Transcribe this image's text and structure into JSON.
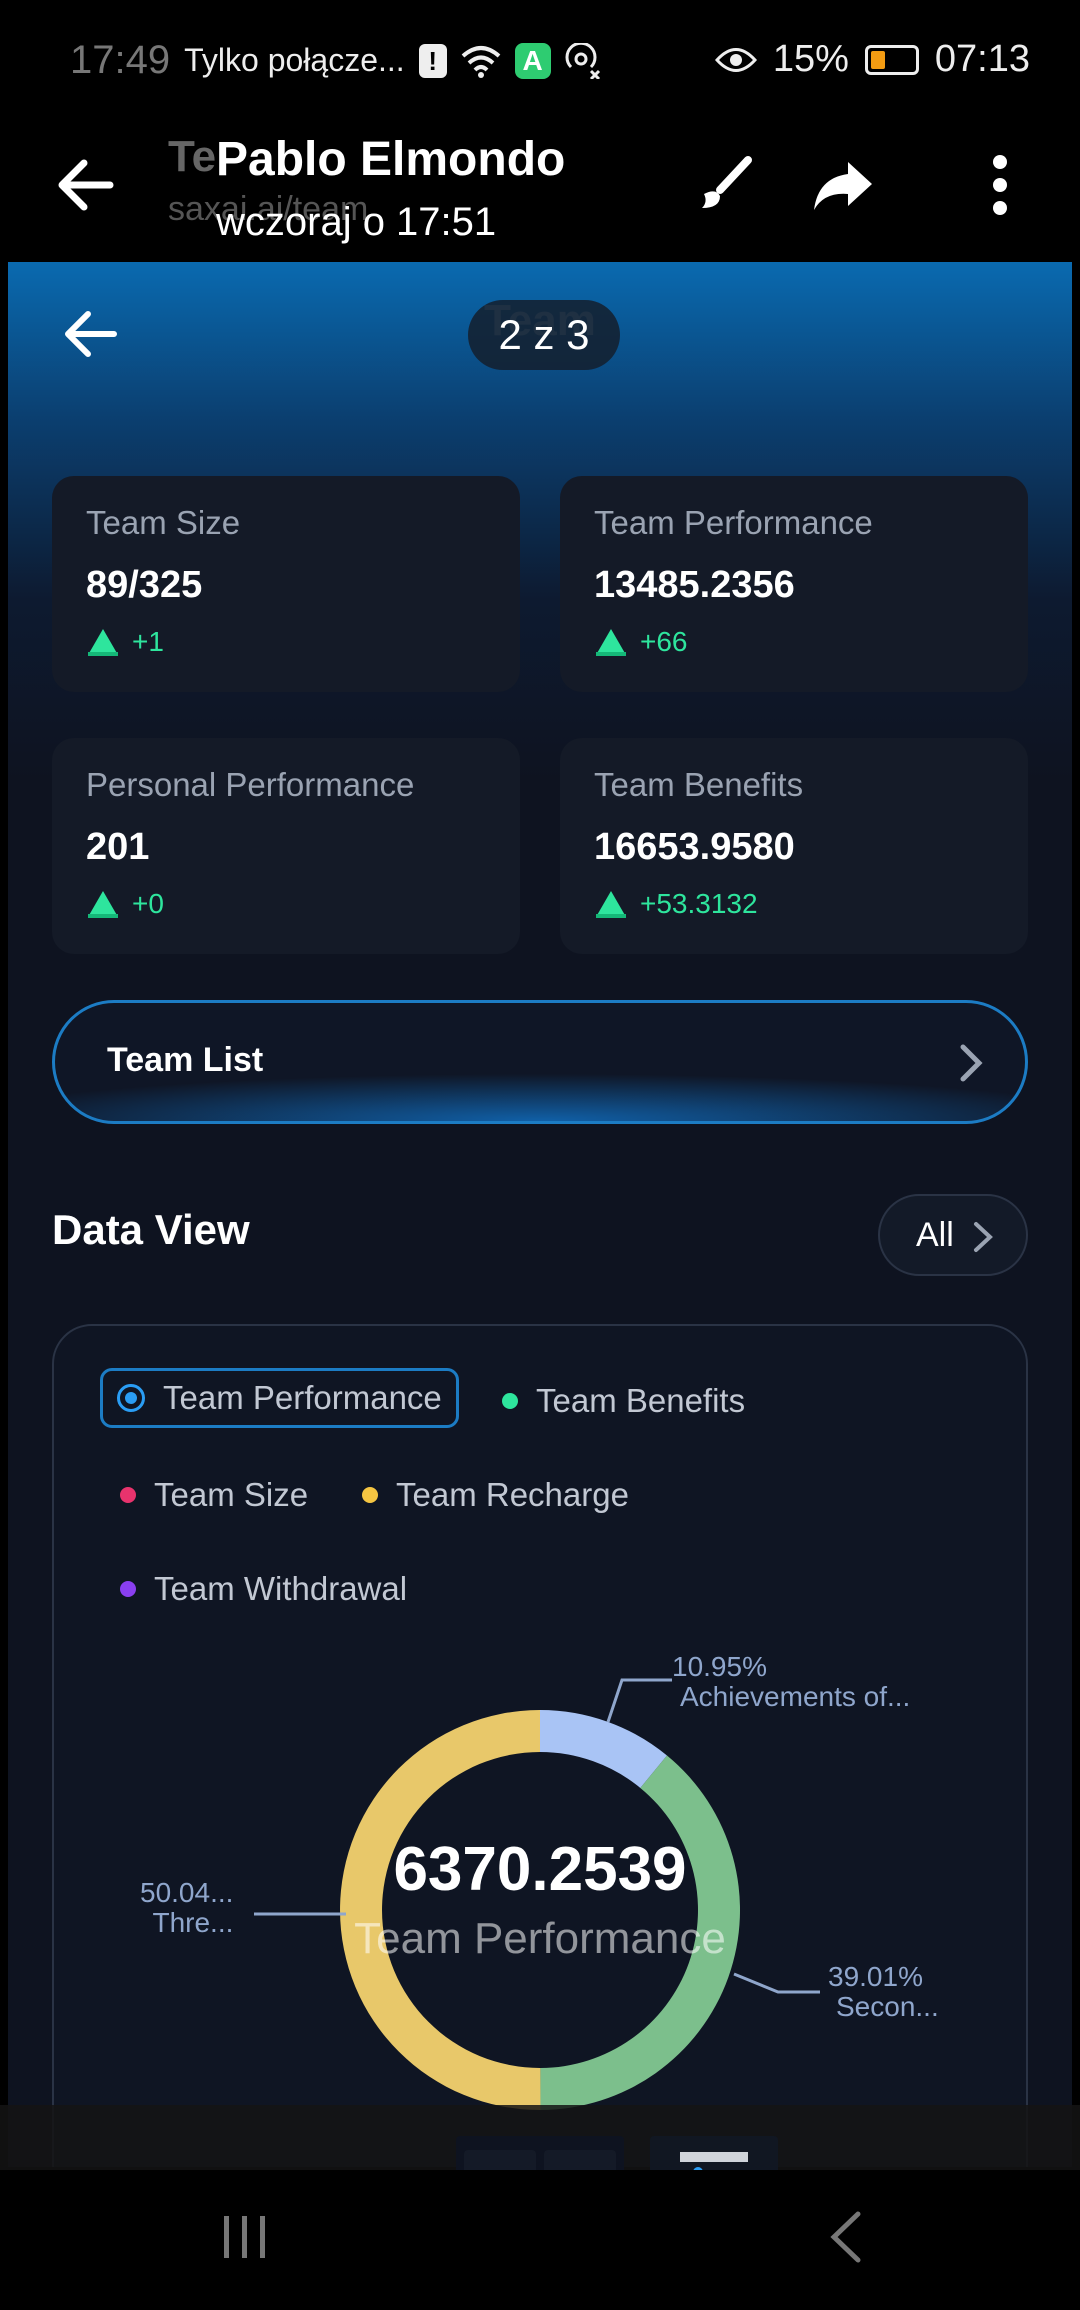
{
  "status_bar": {
    "time_ghost": "17:49",
    "carrier": "Tylko połącze...",
    "battery": "15%",
    "time": "07:13"
  },
  "viewer_header": {
    "ghost_title": "Te",
    "ghost_url": "saxai.ai/team",
    "sender": "Pablo Elmondo",
    "date": "wczoraj o 17:51"
  },
  "app": {
    "title": "Team",
    "counter": "2 z 3",
    "cards": [
      {
        "label": "Team Size",
        "value": "89/325",
        "delta": "+1"
      },
      {
        "label": "Team Performance",
        "value": "13485.2356",
        "delta": "+66"
      },
      {
        "label": "Personal Performance",
        "value": "201",
        "delta": "+0"
      },
      {
        "label": "Team Benefits",
        "value": "16653.9580",
        "delta": "+53.3132"
      }
    ],
    "team_list_label": "Team List",
    "data_view_title": "Data View",
    "all_label": "All",
    "legend": [
      {
        "label": "Team Performance",
        "color": "#2a9df4",
        "active": true
      },
      {
        "label": "Team Benefits",
        "color": "#2ee59d"
      },
      {
        "label": "Team Size",
        "color": "#e8336d"
      },
      {
        "label": "Team Recharge",
        "color": "#f5c542"
      },
      {
        "label": "Team Withdrawal",
        "color": "#8a3ff0"
      }
    ],
    "donut": {
      "center_value": "6370.2539",
      "center_label": "Team Performance",
      "segments": [
        {
          "percent_label": "10.95%",
          "name": "Achievements of...",
          "value": 10.95,
          "color": "#a9c4f5"
        },
        {
          "percent_label": "39.01%",
          "name": "Secon...",
          "value": 39.01,
          "color": "#7cbf8c"
        },
        {
          "percent_label": "50.04...",
          "name": "Thre...",
          "value": 50.04,
          "color": "#e8c86a"
        }
      ]
    }
  },
  "colors": {
    "accent": "#1c7cc4",
    "positive": "#2ee59d",
    "background": "#0e1320",
    "card": "#141a27"
  }
}
